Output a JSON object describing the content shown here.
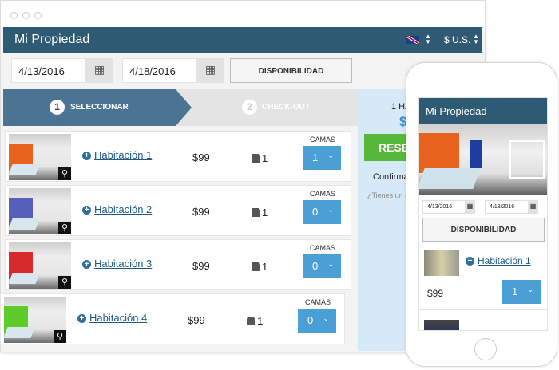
{
  "header": {
    "title": "Mi Propiedad",
    "currency": "$ U.S.",
    "language_flag": "uk-flag-icon"
  },
  "search": {
    "checkin": "4/13/2016",
    "checkout": "4/18/2016",
    "availability_label": "DISPONIBILIDAD"
  },
  "steps": [
    {
      "num": "1",
      "label": "SELECCIONAR"
    },
    {
      "num": "2",
      "label": "CHECK-OUT"
    }
  ],
  "summary": {
    "rooms_text": "1 HA",
    "price_text": "$",
    "reserve_label": "RESER",
    "confirm_text": "Confirma",
    "promo_link": "¿Tienes un c"
  },
  "rooms": [
    {
      "name": "Habitación 1",
      "price": "$99",
      "guests": "1",
      "beds_label": "CAMAS",
      "beds": "1",
      "wall": "#e8641e"
    },
    {
      "name": "Habitación 2",
      "price": "$99",
      "guests": "1",
      "beds_label": "CAMAS",
      "beds": "0",
      "wall": "#5560b8"
    },
    {
      "name": "Habitación 3",
      "price": "$99",
      "guests": "1",
      "beds_label": "CAMAS",
      "beds": "0",
      "wall": "#d72a2a"
    },
    {
      "name": "Habitación 4",
      "price": "$99",
      "guests": "1",
      "beds_label": "CAMAS",
      "beds": "0",
      "wall": "#5ccc2a"
    }
  ],
  "mobile": {
    "title": "Mi Propiedad",
    "checkin": "4/13/2016",
    "checkout": "4/18/2016",
    "availability_label": "DISPONIBILIDAD",
    "room_name": "Habitación 1",
    "room_price": "$99",
    "beds": "1"
  },
  "colors": {
    "header": "#2e5a74",
    "accent": "#4a9fd5",
    "reserve": "#56b93a",
    "panel": "#d6e9f6"
  }
}
